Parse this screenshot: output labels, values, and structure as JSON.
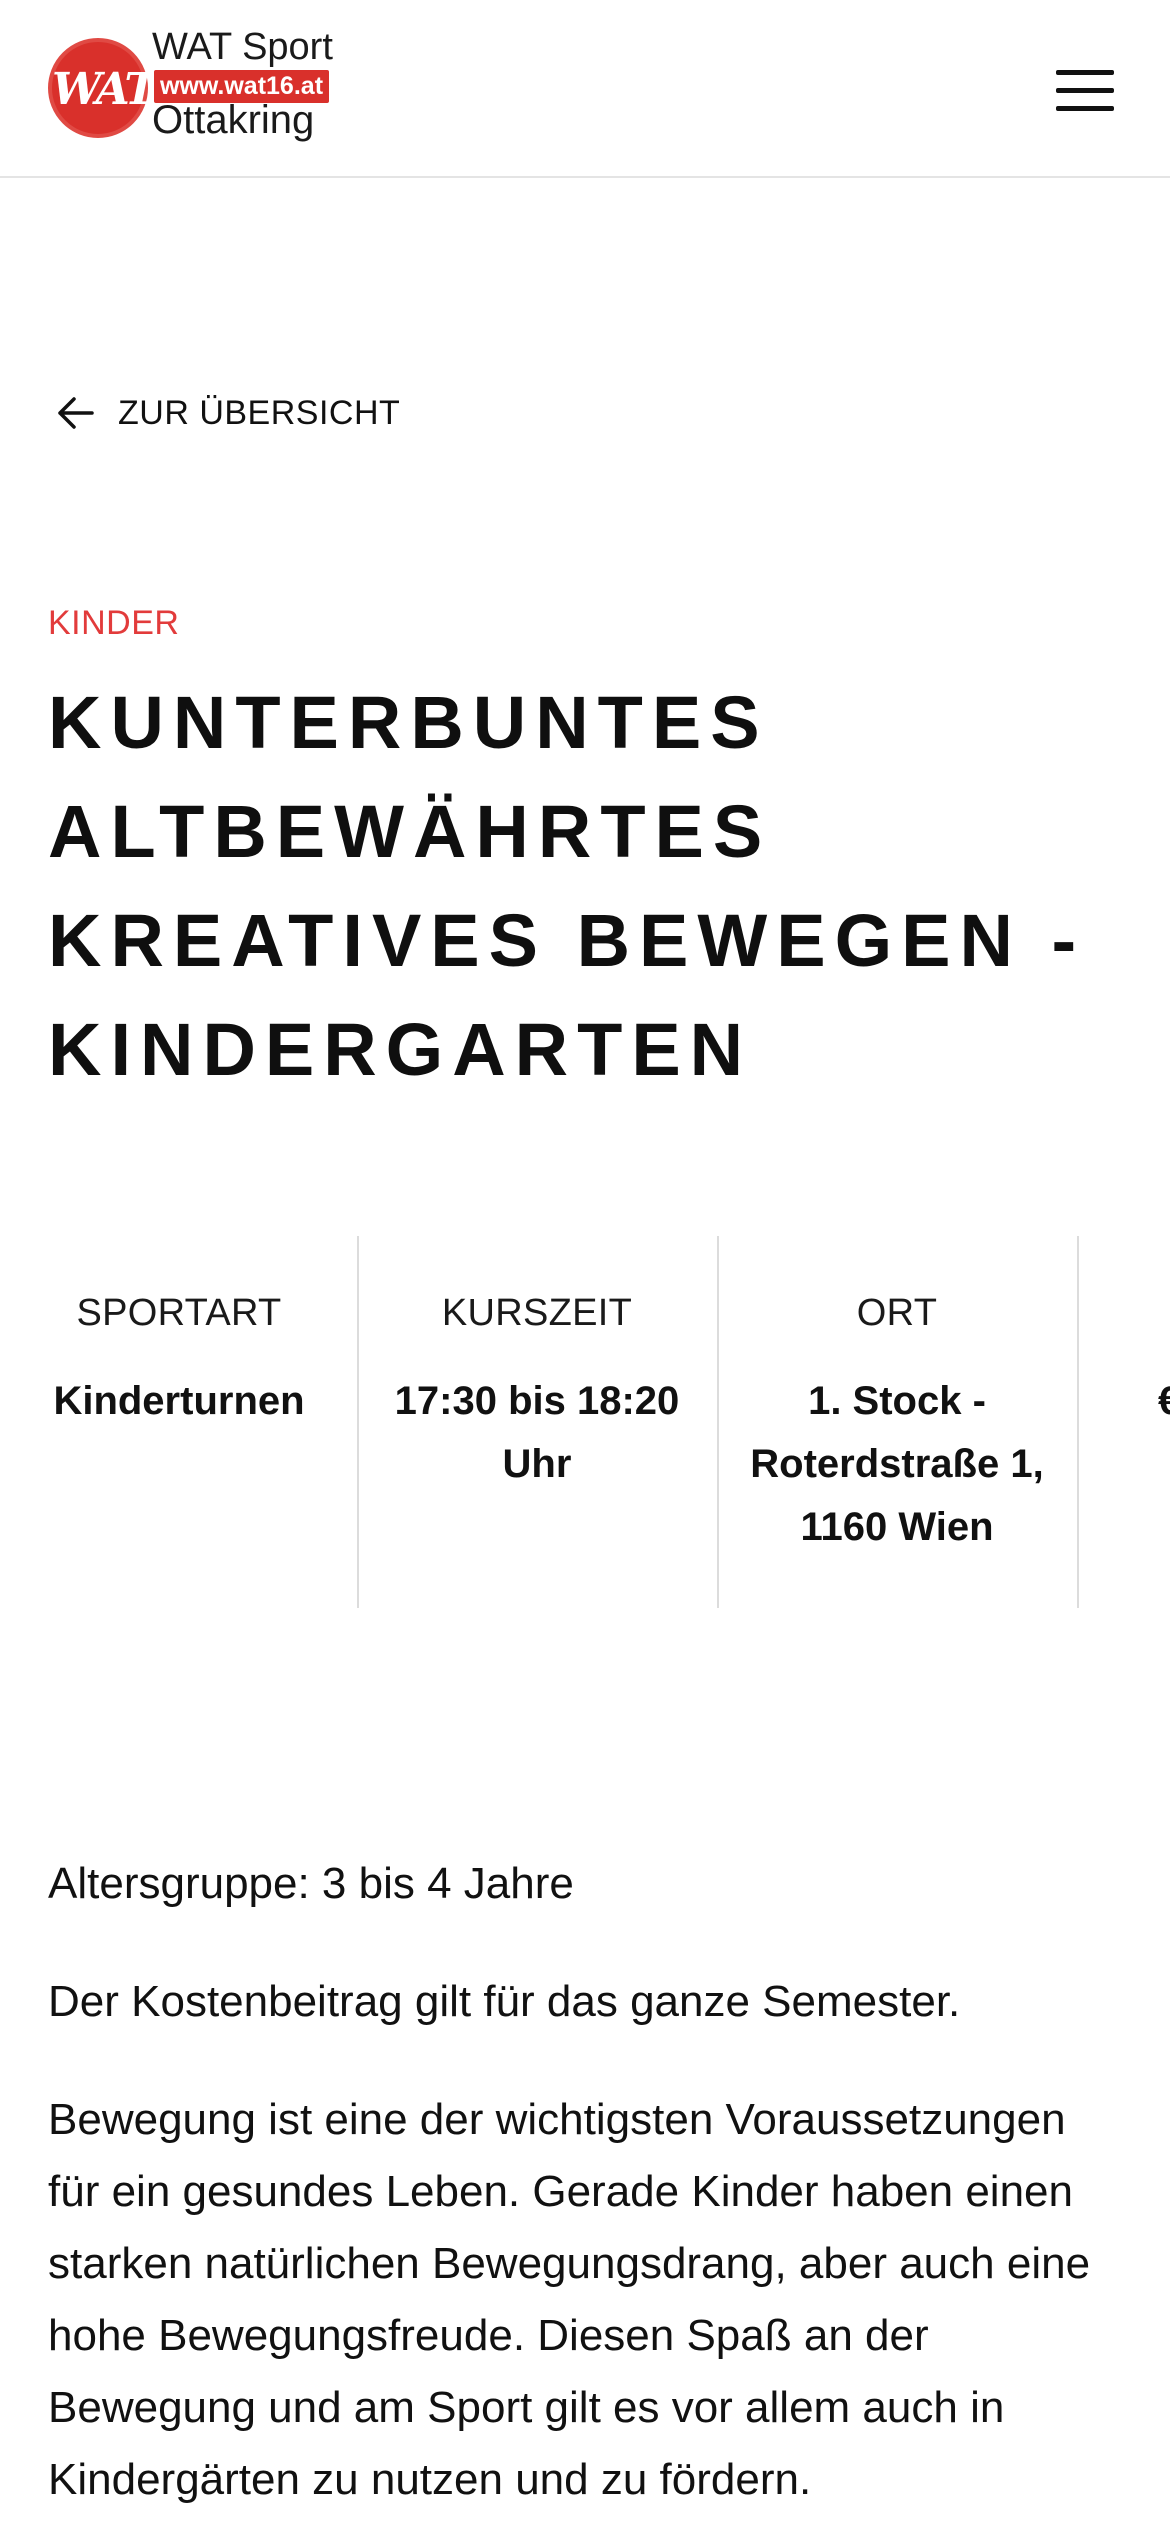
{
  "header": {
    "logo": {
      "circle_text": "WAT",
      "line1": "WAT Sport",
      "web": "www.wat16.at",
      "line3": "Ottakring"
    },
    "menu_icon": "hamburger-menu-icon"
  },
  "back_link": {
    "icon": "arrow-left-icon",
    "label": "ZUR ÜBERSICHT"
  },
  "course": {
    "category": "KINDER",
    "title": "KUNTERBUNTES ALTBEWÄHRTES KREATIVES BEWEGEN - KINDERGARTEN",
    "info": [
      {
        "label": "SPORTART",
        "value": "Kinderturnen"
      },
      {
        "label": "KURSZEIT",
        "value": "17:30 bis 18:20 Uhr"
      },
      {
        "label": "ORT",
        "value": "1. Stock - Roterdstraße 1, 1160 Wien"
      },
      {
        "label": "",
        "value": "€"
      }
    ]
  },
  "description": {
    "paragraphs": [
      "Altersgruppe: 3 bis 4 Jahre",
      "Der Kostenbeitrag gilt für das ganze Semester.",
      "Bewegung ist eine der wichtigsten Voraussetzungen für ein gesundes Leben. Gerade Kinder haben einen starken natürlichen Bewegungsdrang, aber auch eine hohe Bewegungsfreude. Diesen Spaß an der Bewegung und am Sport gilt es vor allem auch in Kindergärten zu nutzen und zu fördern."
    ]
  },
  "colors": {
    "accent": "#e23b3b",
    "brand_red": "#d9302b",
    "text": "#111111",
    "divider": "#dcdcdc"
  }
}
